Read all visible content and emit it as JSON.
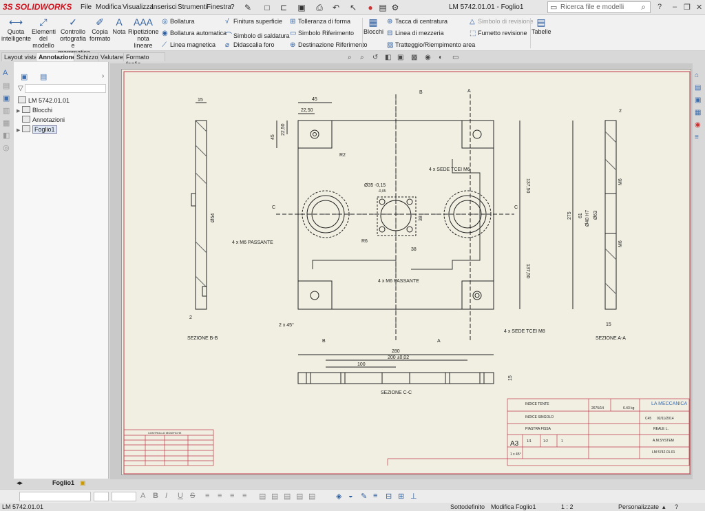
{
  "app": {
    "brand_prefix": "3S",
    "brand": "SOLIDWORKS",
    "document_title": "LM 5742.01.01 - Foglio1"
  },
  "menu": [
    "File",
    "Modifica",
    "Visualizza",
    "Inserisci",
    "Strumenti",
    "Finestra",
    "?"
  ],
  "search": {
    "placeholder": "Ricerca file e modelli"
  },
  "window_controls": {
    "help": "?",
    "minimize": "–",
    "restore": "❐",
    "close": "✕"
  },
  "ribbon": {
    "big_buttons": [
      {
        "label": "Quota intelligente",
        "icon": "smart-dimension-icon"
      },
      {
        "label": "Elementi del modello",
        "icon": "model-items-icon"
      },
      {
        "label": "Controllo ortografia e grammatica",
        "icon": "spell-check-icon"
      },
      {
        "label": "Copia formato",
        "icon": "format-painter-icon"
      },
      {
        "label": "Nota",
        "icon": "note-icon"
      },
      {
        "label": "Ripetizione nota lineare",
        "icon": "linear-note-pattern-icon"
      },
      {
        "label": "Blocchi",
        "icon": "blocks-icon"
      },
      {
        "label": "Tabelle",
        "icon": "tables-icon"
      }
    ],
    "col1": [
      "Bollatura",
      "Bollatura automatica",
      "Linea magnetica"
    ],
    "col2": [
      "Finitura superficie",
      "Simbolo di saldatura",
      "Didascalia foro"
    ],
    "col3": [
      "Tolleranza di forma",
      "Simbolo Riferimento",
      "Destinazione Riferimento"
    ],
    "col4": [
      "Tacca di centratura",
      "Linea di mezzeria",
      "Tratteggio/Riempimento area"
    ],
    "col5": [
      "Simbolo di revisione",
      "Fumetto revisione"
    ]
  },
  "tabs": [
    {
      "label": "Layout vista",
      "active": false
    },
    {
      "label": "Annotazione",
      "active": true
    },
    {
      "label": "Schizzo",
      "active": false
    },
    {
      "label": "Valutare",
      "active": false
    },
    {
      "label": "Formato foglio",
      "active": false
    }
  ],
  "tree": {
    "root": "LM 5742.01.01",
    "children": [
      "Blocchi",
      "Annotazioni",
      "Foglio1"
    ]
  },
  "drawing": {
    "dims_top": [
      "45",
      "22,50",
      "22,50",
      "45",
      "R2"
    ],
    "dims_side": [
      "137,50",
      "137,50"
    ],
    "callouts": [
      "4 x SEDE TCEI M6",
      "Ø35 -0,15",
      "-0,05",
      "4 x M6 PASSANTE",
      "4 x M6 PASSANTE",
      "4 x SEDE TCEI M8",
      "38",
      "38",
      "R6",
      "2 x 45°"
    ],
    "section_labels": [
      "SEZIONE B-B",
      "SEZIONE A-A",
      "SEZIONE C-C"
    ],
    "cut_letters": [
      "B",
      "B",
      "A",
      "A",
      "C",
      "C"
    ],
    "left_view_dims": [
      "15",
      "Ø54",
      "2"
    ],
    "right_view_dims": [
      "2",
      "M6",
      "275",
      "61",
      "Ø40 H7",
      "Ø63",
      "M6",
      "15"
    ],
    "bottom_dims": [
      "280",
      "200 ±0,02",
      "100",
      "15"
    ],
    "title_block": {
      "company": "LA MECCANICA",
      "index_general": "INDICE TENTE",
      "index_single": "INDICE SINGOLO",
      "part_name": "PIASTRA FISSA",
      "order": "2675/14",
      "weight": "6.43 kg",
      "date": "02/11/2014",
      "designer": "REALE L.",
      "material": "A.M.SYSTEM",
      "drawing_no": "LM 5742.01.01",
      "format": "A3",
      "sheet": "1/1",
      "scale": "1:2",
      "qty": "1",
      "tolerance": "1 x 45°",
      "material_grade": "C45"
    },
    "revision_table_title": "CONTROLLO MODIFICHE"
  },
  "sheet_tabs": [
    "Foglio1"
  ],
  "status": {
    "doc": "LM 5742.01.01",
    "state": "Sottodefinito",
    "mode": "Modifica Foglio1",
    "scale": "1 : 2",
    "units": "Personalizzate"
  }
}
